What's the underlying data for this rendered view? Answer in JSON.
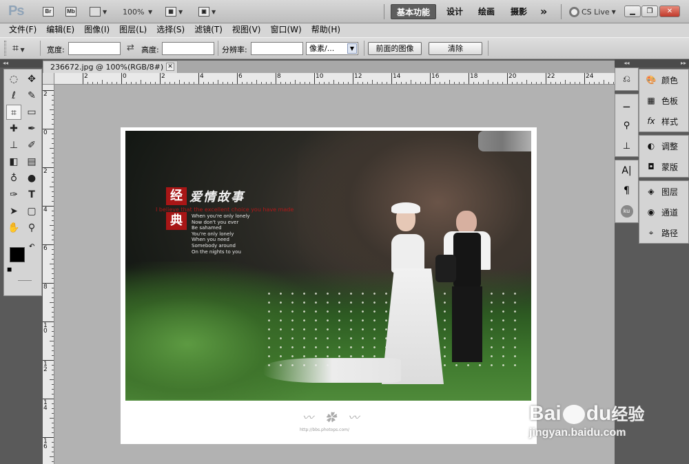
{
  "appbar": {
    "logo": "Ps",
    "bridge_label": "Br",
    "minibridge_label": "Mb",
    "zoom": "100%",
    "workspaces": [
      "基本功能",
      "设计",
      "绘画",
      "摄影"
    ],
    "more": "»",
    "cslive": "CS Live"
  },
  "menubar": {
    "items": [
      "文件(F)",
      "编辑(E)",
      "图像(I)",
      "图层(L)",
      "选择(S)",
      "滤镜(T)",
      "视图(V)",
      "窗口(W)",
      "帮助(H)"
    ]
  },
  "options": {
    "width_label": "宽度:",
    "width_value": "",
    "height_label": "高度:",
    "height_value": "",
    "resolution_label": "分辨率:",
    "resolution_value": "",
    "unit_value": "像素/...",
    "front_image_button": "前面的图像",
    "clear_button": "清除"
  },
  "document": {
    "tab_title": "236672.jpg @ 100%(RGB/8#)",
    "h_ruler_labels": [
      "2",
      "0",
      "2",
      "4",
      "6",
      "8",
      "10",
      "12",
      "14",
      "16",
      "18",
      "20",
      "22",
      "24"
    ],
    "v_ruler_labels": [
      "2",
      "0",
      "2",
      "4",
      "6",
      "8",
      "10",
      "12",
      "14",
      "16"
    ]
  },
  "photo": {
    "title_char_1": "经",
    "title_char_2": "典",
    "title_text": "爱情故事",
    "red_line": "I believe that the excellent choice you have made",
    "poem_lines": [
      "When you're only lonely",
      "Now don't you ever",
      "Be sahamed",
      "You're only lonely",
      "When you need",
      "Somebody around",
      "On the nights to you"
    ],
    "footer_url": "http://bbs.photops.com/"
  },
  "panels": {
    "items": [
      "颜色",
      "色板",
      "样式",
      "调整",
      "蒙版",
      "图层",
      "通道",
      "路径"
    ]
  },
  "watermark": {
    "brand": "Bai",
    "brand2": "du",
    "brand_cn": "经验",
    "url": "jingyan.baidu.com"
  },
  "colors": {
    "foreground": "#000000",
    "background": "#ffffff",
    "title_red": "#b01818"
  }
}
